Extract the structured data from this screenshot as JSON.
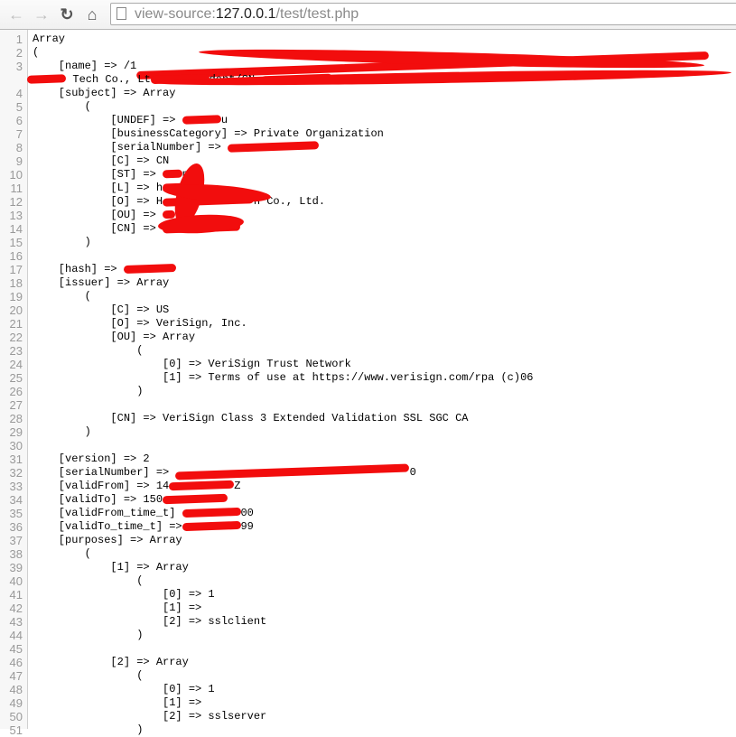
{
  "browser": {
    "back_icon": "arrow-left-icon",
    "forward_icon": "arrow-right-icon",
    "reload_icon": "reload-icon",
    "home_icon": "home-icon",
    "url_prefix": "view-source:",
    "url_host": "127.0.0.1",
    "url_path": "/test/test.php"
  },
  "colors": {
    "redaction": "#f20d0d",
    "line_number": "#999999"
  },
  "lines": [
    {
      "n": "1",
      "s": [
        {
          "t": "Array"
        }
      ]
    },
    {
      "n": "2",
      "s": [
        {
          "t": "("
        }
      ]
    },
    {
      "n": "3",
      "s": [
        {
          "t": "    [name] => /1"
        },
        {
          "r": 88
        }
      ]
    },
    {
      "n": "",
      "wrap": true,
      "s": [
        {
          "r": 6
        },
        {
          "t": " Tech Co., Lt"
        },
        {
          "r": 9
        },
        {
          "t": "dent/CN="
        },
        {
          "r": 11
        },
        {
          "t": "om"
        }
      ]
    },
    {
      "n": "4",
      "s": [
        {
          "t": "    [subject] => Array"
        }
      ]
    },
    {
      "n": "5",
      "s": [
        {
          "t": "        ("
        }
      ]
    },
    {
      "n": "6",
      "s": [
        {
          "t": "            [UNDEF] => "
        },
        {
          "r": 6
        },
        {
          "t": "u"
        }
      ]
    },
    {
      "n": "7",
      "s": [
        {
          "t": "            [businessCategory] => Private Organization"
        }
      ]
    },
    {
      "n": "8",
      "s": [
        {
          "t": "            [serialNumber] => "
        },
        {
          "r": 14
        }
      ]
    },
    {
      "n": "9",
      "s": [
        {
          "t": "            [C] => CN"
        }
      ]
    },
    {
      "n": "10",
      "s": [
        {
          "t": "            [ST] => "
        },
        {
          "r": 3
        },
        {
          "t": "ng"
        }
      ]
    },
    {
      "n": "11",
      "s": [
        {
          "t": "            [L] => h"
        },
        {
          "r": 4
        },
        {
          "t": "u"
        }
      ]
    },
    {
      "n": "12",
      "s": [
        {
          "t": "            [O] => H"
        },
        {
          "r": 14
        },
        {
          "t": "h Co., Ltd."
        }
      ]
    },
    {
      "n": "13",
      "s": [
        {
          "t": "            [OU] => "
        },
        {
          "r": 2
        },
        {
          "t": "dep"
        }
      ]
    },
    {
      "n": "14",
      "s": [
        {
          "t": "            [CN] => "
        },
        {
          "r": 12
        }
      ]
    },
    {
      "n": "15",
      "s": [
        {
          "t": "        )"
        }
      ]
    },
    {
      "n": "16",
      "s": [
        {
          "t": ""
        }
      ]
    },
    {
      "n": "17",
      "s": [
        {
          "t": "    [hash] => "
        },
        {
          "r": 8
        }
      ]
    },
    {
      "n": "18",
      "s": [
        {
          "t": "    [issuer] => Array"
        }
      ]
    },
    {
      "n": "19",
      "s": [
        {
          "t": "        ("
        }
      ]
    },
    {
      "n": "20",
      "s": [
        {
          "t": "            [C] => US"
        }
      ]
    },
    {
      "n": "21",
      "s": [
        {
          "t": "            [O] => VeriSign, Inc."
        }
      ]
    },
    {
      "n": "22",
      "s": [
        {
          "t": "            [OU] => Array"
        }
      ]
    },
    {
      "n": "23",
      "s": [
        {
          "t": "                ("
        }
      ]
    },
    {
      "n": "24",
      "s": [
        {
          "t": "                    [0] => VeriSign Trust Network"
        }
      ]
    },
    {
      "n": "25",
      "s": [
        {
          "t": "                    [1] => Terms of use at https://www.verisign.com/rpa (c)06"
        }
      ]
    },
    {
      "n": "26",
      "s": [
        {
          "t": "                )"
        }
      ]
    },
    {
      "n": "27",
      "s": [
        {
          "t": ""
        }
      ]
    },
    {
      "n": "28",
      "s": [
        {
          "t": "            [CN] => VeriSign Class 3 Extended Validation SSL SGC CA"
        }
      ]
    },
    {
      "n": "29",
      "s": [
        {
          "t": "        )"
        }
      ]
    },
    {
      "n": "30",
      "s": [
        {
          "t": ""
        }
      ]
    },
    {
      "n": "31",
      "s": [
        {
          "t": "    [version] => 2"
        }
      ]
    },
    {
      "n": "32",
      "s": [
        {
          "t": "    [serialNumber] => "
        },
        {
          "r": 36
        },
        {
          "t": "0"
        }
      ]
    },
    {
      "n": "33",
      "s": [
        {
          "t": "    [validFrom] => 14"
        },
        {
          "r": 10
        },
        {
          "t": "Z"
        }
      ]
    },
    {
      "n": "34",
      "s": [
        {
          "t": "    [validTo] => 150"
        },
        {
          "r": 10
        }
      ]
    },
    {
      "n": "35",
      "s": [
        {
          "t": "    [validFrom_time_t] "
        },
        {
          "r": 9
        },
        {
          "t": "00"
        }
      ]
    },
    {
      "n": "36",
      "s": [
        {
          "t": "    [validTo_time_t] =>"
        },
        {
          "r": 9
        },
        {
          "t": "99"
        }
      ]
    },
    {
      "n": "37",
      "s": [
        {
          "t": "    [purposes] => Array"
        }
      ]
    },
    {
      "n": "38",
      "s": [
        {
          "t": "        ("
        }
      ]
    },
    {
      "n": "39",
      "s": [
        {
          "t": "            [1] => Array"
        }
      ]
    },
    {
      "n": "40",
      "s": [
        {
          "t": "                ("
        }
      ]
    },
    {
      "n": "41",
      "s": [
        {
          "t": "                    [0] => 1"
        }
      ]
    },
    {
      "n": "42",
      "s": [
        {
          "t": "                    [1] => "
        }
      ]
    },
    {
      "n": "43",
      "s": [
        {
          "t": "                    [2] => sslclient"
        }
      ]
    },
    {
      "n": "44",
      "s": [
        {
          "t": "                )"
        }
      ]
    },
    {
      "n": "45",
      "s": [
        {
          "t": ""
        }
      ]
    },
    {
      "n": "46",
      "s": [
        {
          "t": "            [2] => Array"
        }
      ]
    },
    {
      "n": "47",
      "s": [
        {
          "t": "                ("
        }
      ]
    },
    {
      "n": "48",
      "s": [
        {
          "t": "                    [0] => 1"
        }
      ]
    },
    {
      "n": "49",
      "s": [
        {
          "t": "                    [1] => "
        }
      ]
    },
    {
      "n": "50",
      "s": [
        {
          "t": "                    [2] => sslserver"
        }
      ]
    },
    {
      "n": "51",
      "s": [
        {
          "t": "                )"
        }
      ]
    }
  ]
}
